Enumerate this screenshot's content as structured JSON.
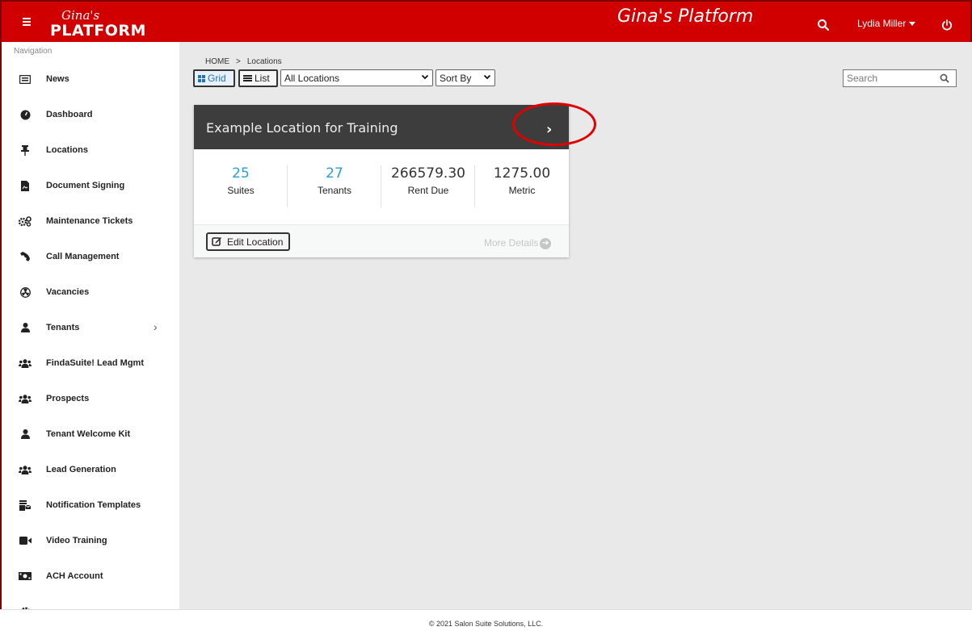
{
  "header": {
    "logo_script": "Gina's",
    "logo_main": "PLATFORM",
    "app_title": "Gina's Platform",
    "user_name": "Lydia Miller",
    "brand_color": "#d10000"
  },
  "sidebar": {
    "heading": "Navigation",
    "items": [
      {
        "label": "News",
        "icon": "newspaper-icon"
      },
      {
        "label": "Dashboard",
        "icon": "gauge-icon"
      },
      {
        "label": "Locations",
        "icon": "pushpin-icon"
      },
      {
        "label": "Document Signing",
        "icon": "document-icon"
      },
      {
        "label": "Maintenance Tickets",
        "icon": "gears-icon"
      },
      {
        "label": "Call Management",
        "icon": "phone-icon"
      },
      {
        "label": "Vacancies",
        "icon": "radioactive-icon"
      },
      {
        "label": "Tenants",
        "icon": "user-icon"
      },
      {
        "label": "FindaSuite! Lead Mgmt",
        "icon": "users-icon"
      },
      {
        "label": "Prospects",
        "icon": "users-icon"
      },
      {
        "label": "Tenant Welcome Kit",
        "icon": "user-icon"
      },
      {
        "label": "Lead Generation",
        "icon": "users-icon"
      },
      {
        "label": "Notification Templates",
        "icon": "mail-bulk-icon"
      },
      {
        "label": "Video Training",
        "icon": "video-icon"
      },
      {
        "label": "ACH Account",
        "icon": "money-bill-icon"
      }
    ]
  },
  "breadcrumb": {
    "home": "HOME",
    "sep": ">",
    "current": "Locations"
  },
  "toolbar": {
    "grid_label": "Grid",
    "list_label": "List",
    "location_select": "All Locations",
    "sort_select": "Sort By",
    "search_placeholder": "Search"
  },
  "card": {
    "title": "Example Location for Training",
    "stats": [
      {
        "value": "25",
        "label": "Suites",
        "color": "#2a9fd6"
      },
      {
        "value": "27",
        "label": "Tenants",
        "color": "#2a9fd6"
      },
      {
        "value": "266579.30",
        "label": "Rent Due",
        "color": "#333333"
      },
      {
        "value": "1275.00",
        "label": "Metric",
        "color": "#333333"
      }
    ],
    "edit_label": "Edit Location",
    "more_details": "More Details"
  },
  "footer": {
    "copyright": "© 2021 Salon Suite Solutions, LLC."
  }
}
